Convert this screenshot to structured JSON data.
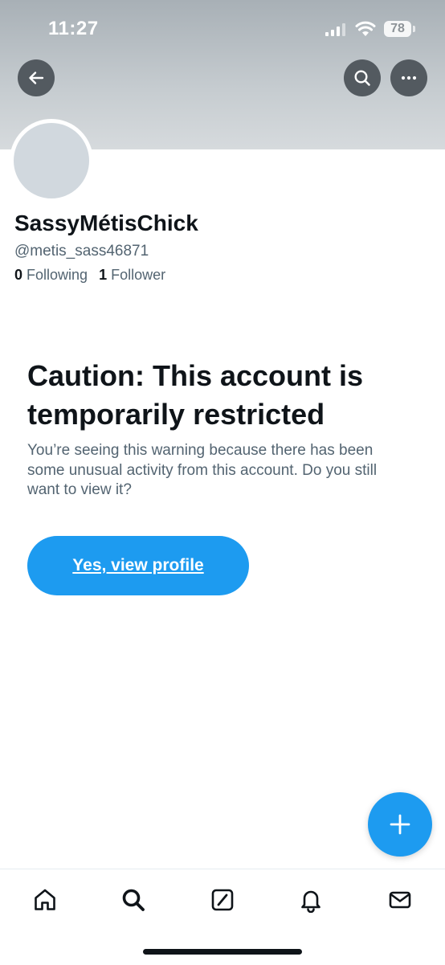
{
  "status_bar": {
    "time": "11:27",
    "battery_level": "78"
  },
  "header": {
    "back_icon": "arrow-left-icon",
    "search_icon": "search-icon",
    "more_icon": "more-horizontal-icon"
  },
  "profile": {
    "display_name": "SassyMétisChick",
    "handle": "@metis_sass46871",
    "following_count": "0",
    "following_label": "Following",
    "followers_count": "1",
    "followers_label": "Follower"
  },
  "warning": {
    "title": "Caution: This account is temporarily restricted",
    "body": "You’re seeing this warning because there has been some unusual activity from this account. Do you still want to view it?",
    "button_label": "Yes, view profile"
  },
  "fab": {
    "icon": "plus-icon"
  },
  "tab_bar": {
    "items": [
      {
        "icon": "home-icon"
      },
      {
        "icon": "search-icon"
      },
      {
        "icon": "grok-icon"
      },
      {
        "icon": "bell-icon"
      },
      {
        "icon": "mail-icon"
      }
    ]
  },
  "colors": {
    "accent": "#1d9bf0",
    "text_primary": "#0f1419",
    "text_secondary": "#536471",
    "header_button": "#535a60"
  }
}
